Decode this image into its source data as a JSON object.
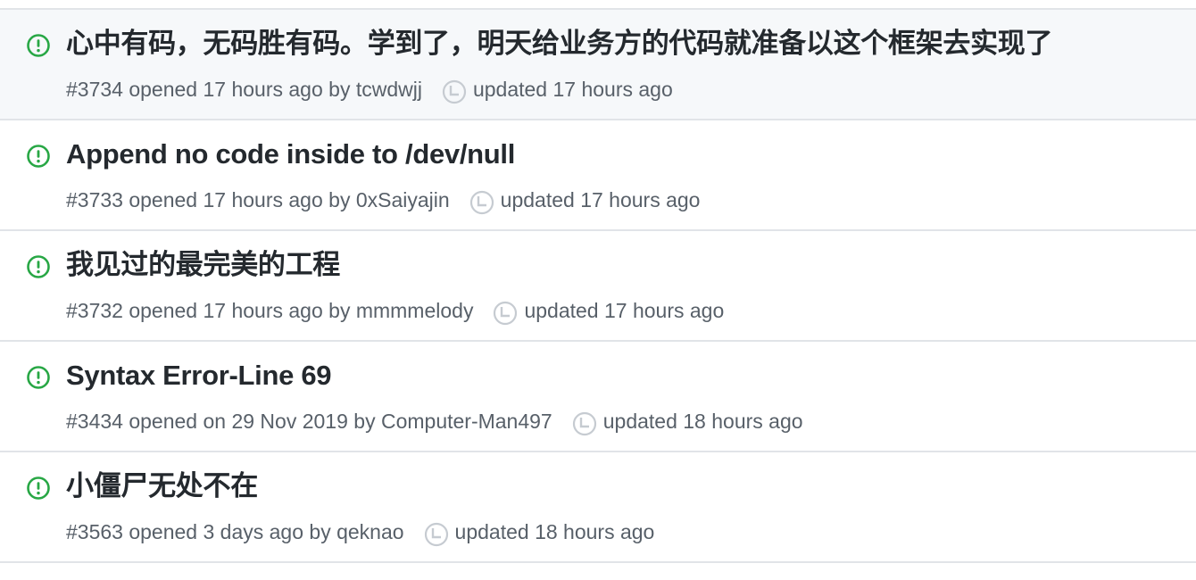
{
  "colors": {
    "open_icon": "#28a745",
    "title": "#24292e",
    "meta": "#586069",
    "clock": "#c6cbd1",
    "hover_bg": "#f6f8fa",
    "divider": "#e1e4e8"
  },
  "issues": [
    {
      "title": "心中有码，无码胜有码。学到了，明天给业务方的代码就准备以这个框架去实现了",
      "opened": "#3734 opened 17 hours ago by tcwdwjj",
      "updated": "updated 17 hours ago",
      "state_icon": "issue-opened-icon",
      "hovered": true
    },
    {
      "title": "Append no code inside to /dev/null",
      "opened": "#3733 opened 17 hours ago by 0xSaiyajin",
      "updated": "updated 17 hours ago",
      "state_icon": "issue-opened-icon",
      "hovered": false
    },
    {
      "title": "我见过的最完美的工程",
      "opened": "#3732 opened 17 hours ago by mmmmelody",
      "updated": "updated 17 hours ago",
      "state_icon": "issue-opened-icon",
      "hovered": false
    },
    {
      "title": "Syntax Error-Line 69",
      "opened": "#3434 opened on 29 Nov 2019 by Computer-Man497",
      "updated": "updated 18 hours ago",
      "state_icon": "issue-opened-icon",
      "hovered": false
    },
    {
      "title": "小僵尸无处不在",
      "opened": "#3563 opened 3 days ago by qeknao",
      "updated": "updated 18 hours ago",
      "state_icon": "issue-opened-icon",
      "hovered": false
    }
  ]
}
